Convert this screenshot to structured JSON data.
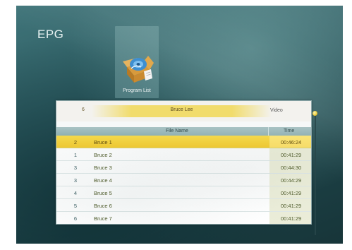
{
  "screen": {
    "title": "EPG"
  },
  "program_list_icon": {
    "icon": "open-box-icon",
    "label": "Program List"
  },
  "info_bar": {
    "count": "6",
    "name": "Bruce Lee",
    "type": "Video"
  },
  "table": {
    "columns": [
      "File Name",
      "Time"
    ],
    "rows": [
      {
        "num": "2",
        "name": "Bruce 1",
        "time": "00:46:24",
        "selected": true
      },
      {
        "num": "1",
        "name": "Bruce 2",
        "time": "00:41:29",
        "selected": false
      },
      {
        "num": "3",
        "name": "Bruce 3",
        "time": "00:44:30",
        "selected": false
      },
      {
        "num": "3",
        "name": "Bruce 4",
        "time": "00:44:29",
        "selected": false
      },
      {
        "num": "4",
        "name": "Bruce 5",
        "time": "00:41:29",
        "selected": false
      },
      {
        "num": "5",
        "name": "Bruce 6",
        "time": "00:41:29",
        "selected": false
      },
      {
        "num": "6",
        "name": "Bruce 7",
        "time": "00:41:29",
        "selected": false
      }
    ]
  },
  "colors": {
    "selection": "#f4d94c",
    "background": "#2c5b61",
    "header": "#a9c3c4"
  }
}
